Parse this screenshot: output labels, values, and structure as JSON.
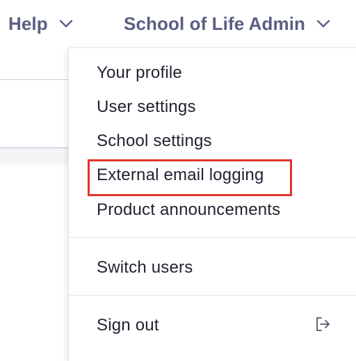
{
  "header": {
    "help_label": "Help",
    "account_label": "School of Life Admin",
    "chevron_icon": "chevron-down-icon"
  },
  "menu": {
    "items": [
      {
        "label": "Your profile"
      },
      {
        "label": "User settings"
      },
      {
        "label": "School settings"
      },
      {
        "label": "External email logging"
      },
      {
        "label": "Product announcements"
      }
    ],
    "switch_users_label": "Switch users",
    "sign_out_label": "Sign out",
    "sign_out_icon": "logout-icon"
  },
  "colors": {
    "nav_text": "#5a5e83",
    "menu_text": "#1f2230",
    "highlight": "#e2342a"
  }
}
